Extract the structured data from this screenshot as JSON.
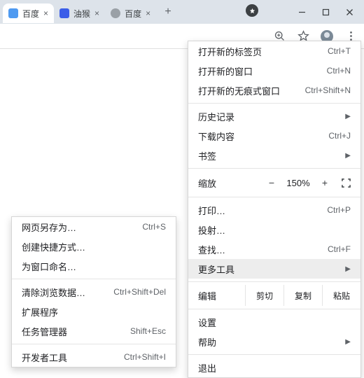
{
  "tabs": [
    {
      "title": "百度",
      "favColor": "#4e9af1"
    },
    {
      "title": "油猴",
      "favColor": "#3b5de8"
    },
    {
      "title": "百度",
      "favColor": "#9aa0a6"
    }
  ],
  "mainMenu": {
    "newTab": {
      "label": "打开新的标签页",
      "shortcut": "Ctrl+T"
    },
    "newWindow": {
      "label": "打开新的窗口",
      "shortcut": "Ctrl+N"
    },
    "newIncognito": {
      "label": "打开新的无痕式窗口",
      "shortcut": "Ctrl+Shift+N"
    },
    "history": {
      "label": "历史记录"
    },
    "downloads": {
      "label": "下载内容",
      "shortcut": "Ctrl+J"
    },
    "bookmarks": {
      "label": "书签"
    },
    "zoom": {
      "label": "缩放",
      "minus": "−",
      "value": "150%",
      "plus": "+"
    },
    "print": {
      "label": "打印…",
      "shortcut": "Ctrl+P"
    },
    "cast": {
      "label": "投射…"
    },
    "find": {
      "label": "查找…",
      "shortcut": "Ctrl+F"
    },
    "moreTools": {
      "label": "更多工具"
    },
    "edit": {
      "label": "编辑",
      "cut": "剪切",
      "copy": "复制",
      "paste": "粘贴"
    },
    "settings": {
      "label": "设置"
    },
    "help": {
      "label": "帮助"
    },
    "exit": {
      "label": "退出"
    }
  },
  "subMenu": {
    "savePageAs": {
      "label": "网页另存为…",
      "shortcut": "Ctrl+S"
    },
    "createShortcut": {
      "label": "创建快捷方式…"
    },
    "nameWindow": {
      "label": "为窗口命名…"
    },
    "clearBrowsing": {
      "label": "清除浏览数据…",
      "shortcut": "Ctrl+Shift+Del"
    },
    "extensions": {
      "label": "扩展程序"
    },
    "taskManager": {
      "label": "任务管理器",
      "shortcut": "Shift+Esc"
    },
    "devTools": {
      "label": "开发者工具",
      "shortcut": "Ctrl+Shift+I"
    }
  }
}
